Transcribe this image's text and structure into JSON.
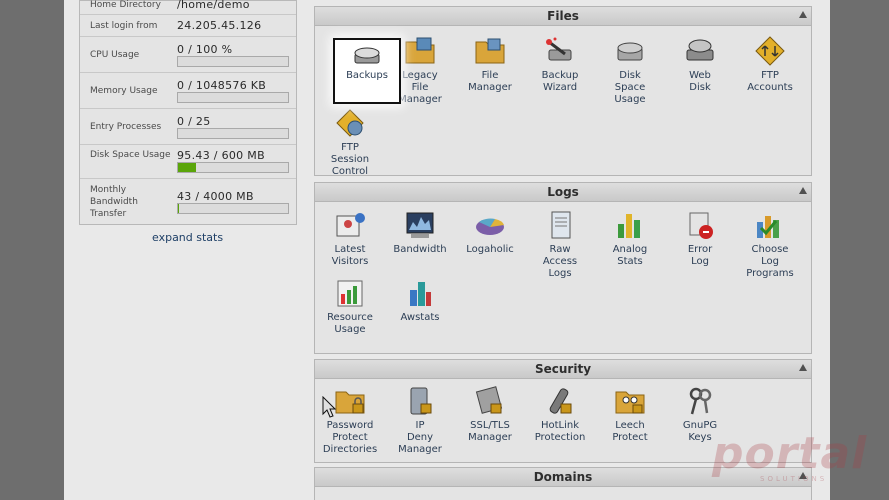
{
  "stats": {
    "rows": [
      {
        "label": "Home Directory",
        "value": "/home/demo"
      },
      {
        "label": "Last login from",
        "value": "24.205.45.126"
      },
      {
        "label": "CPU Usage",
        "value": "0 / 100 %",
        "usage": 0
      },
      {
        "label": "Memory Usage",
        "value": "0 / 1048576 KB",
        "usage": 0
      },
      {
        "label": "Entry Processes",
        "value": "0 / 25",
        "usage": 0
      },
      {
        "label": "Disk Space Usage",
        "value": "95.43 / 600 MB",
        "usage": 0.16
      },
      {
        "label": "Monthly Bandwidth Transfer",
        "value": "43 / 4000 MB",
        "usage": 0.01
      }
    ],
    "expand_label": "expand stats"
  },
  "files": {
    "title": "Files",
    "items": [
      {
        "label": "Backups",
        "icon": "backups-icon"
      },
      {
        "label": "Legacy File Manager",
        "icon": "legacy-file-manager-icon"
      },
      {
        "label": "File Manager",
        "icon": "file-manager-icon"
      },
      {
        "label": "Backup Wizard",
        "icon": "backup-wizard-icon"
      },
      {
        "label": "Disk Space Usage",
        "icon": "disk-space-usage-icon"
      },
      {
        "label": "Web Disk",
        "icon": "web-disk-icon"
      },
      {
        "label": "FTP Accounts",
        "icon": "ftp-accounts-icon"
      },
      {
        "label": "FTP Session Control",
        "icon": "ftp-session-control-icon"
      }
    ]
  },
  "logs": {
    "title": "Logs",
    "items": [
      {
        "label": "Latest Visitors",
        "icon": "latest-visitors-icon"
      },
      {
        "label": "Bandwidth",
        "icon": "bandwidth-icon"
      },
      {
        "label": "Logaholic",
        "icon": "logaholic-icon"
      },
      {
        "label": "Raw Access Logs",
        "icon": "raw-access-logs-icon"
      },
      {
        "label": "Analog Stats",
        "icon": "analog-stats-icon"
      },
      {
        "label": "Error Log",
        "icon": "error-log-icon"
      },
      {
        "label": "Choose Log Programs",
        "icon": "choose-log-programs-icon"
      },
      {
        "label": "Resource Usage",
        "icon": "resource-usage-icon"
      },
      {
        "label": "Awstats",
        "icon": "awstats-icon"
      }
    ]
  },
  "security": {
    "title": "Security",
    "items": [
      {
        "label": "Password Protect Directories",
        "icon": "password-protect-icon"
      },
      {
        "label": "IP Deny Manager",
        "icon": "ip-deny-icon"
      },
      {
        "label": "SSL/TLS Manager",
        "icon": "ssl-tls-icon"
      },
      {
        "label": "HotLink Protection",
        "icon": "hotlink-icon"
      },
      {
        "label": "Leech Protect",
        "icon": "leech-protect-icon"
      },
      {
        "label": "GnuPG Keys",
        "icon": "gnupg-keys-icon"
      }
    ]
  },
  "domains": {
    "title": "Domains"
  },
  "watermark": {
    "text": "portal",
    "sub": "SOLUTIONS"
  }
}
